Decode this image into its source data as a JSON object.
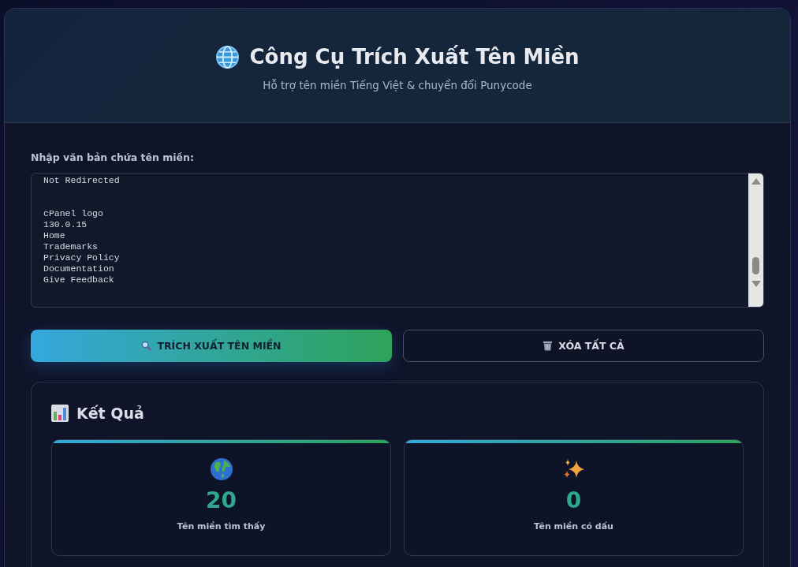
{
  "header": {
    "title": "Công Cụ Trích Xuất Tên Miền",
    "subtitle": "Hỗ trợ tên miền Tiếng Việt & chuyển đổi Punycode"
  },
  "input": {
    "label": "Nhập văn bản chứa tên miền:",
    "value_blocks": [
      [
        "Not Redirected"
      ],
      [
        "cPanel logo",
        "130.0.15",
        "Home",
        "Trademarks",
        "Privacy Policy",
        "Documentation",
        "Give Feedback"
      ]
    ]
  },
  "buttons": [
    {
      "kind": "primary",
      "label": "TRÍCH XUẤT TÊN MIỀN"
    },
    {
      "kind": "secondary",
      "label": "XÓA TẤT CẢ"
    }
  ],
  "results": {
    "title": "Kết Quả",
    "stats": [
      {
        "kind": "globe",
        "value": "20",
        "label": "Tên miền tìm thấy"
      },
      {
        "kind": "sparkles",
        "value": "0",
        "label": "Tên miền có dấu"
      }
    ]
  }
}
